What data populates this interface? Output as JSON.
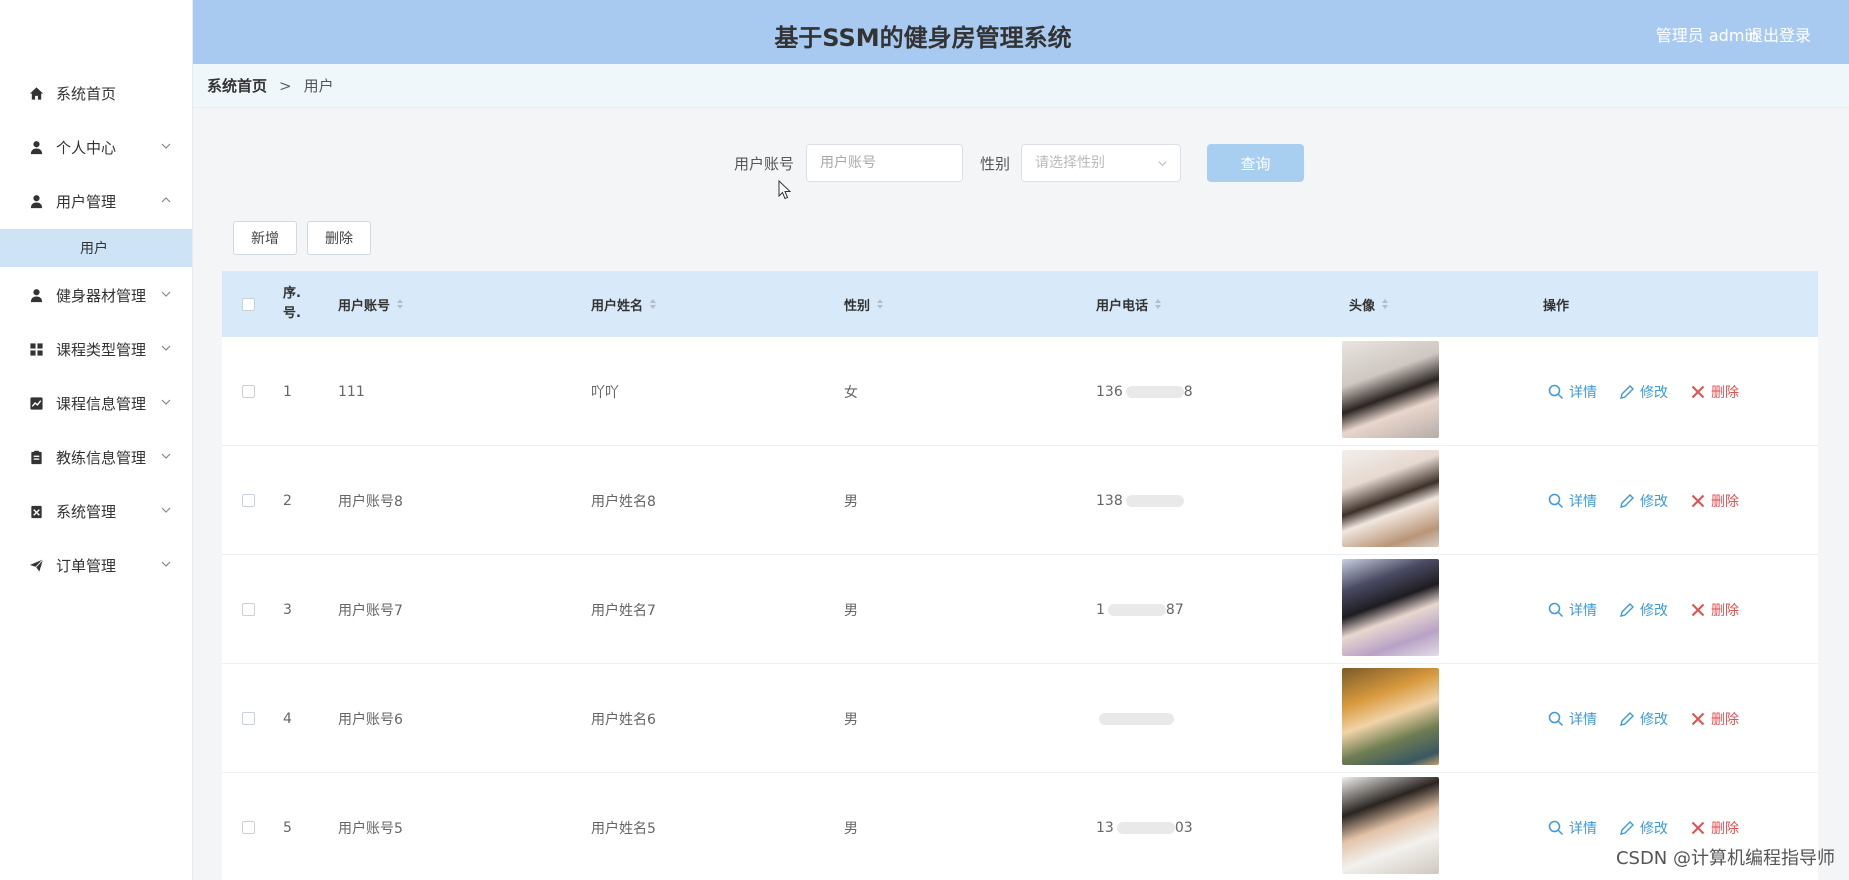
{
  "header": {
    "title": "基于SSM的健身房管理系统",
    "admin_label": "管理员 admin",
    "logout_label": "退出登录"
  },
  "sidebar": {
    "items": [
      {
        "label": "系统首页",
        "icon": "home-icon"
      },
      {
        "label": "个人中心",
        "icon": "user-icon"
      },
      {
        "label": "用户管理",
        "icon": "user-icon"
      },
      {
        "label": "健身器材管理",
        "icon": "user-icon"
      },
      {
        "label": "课程类型管理",
        "icon": "grid-icon"
      },
      {
        "label": "课程信息管理",
        "icon": "chart-icon"
      },
      {
        "label": "教练信息管理",
        "icon": "clipboard-icon"
      },
      {
        "label": "系统管理",
        "icon": "gear-icon"
      },
      {
        "label": "订单管理",
        "icon": "send-icon"
      }
    ],
    "sub_item": "用户"
  },
  "breadcrumb": {
    "home": "系统首页",
    "separator": ">",
    "current": "用户"
  },
  "search": {
    "account_label": "用户账号",
    "account_placeholder": "用户账号",
    "gender_label": "性别",
    "gender_placeholder": "请选择性别",
    "query_label": "查询"
  },
  "toolbar": {
    "add_label": "新增",
    "delete_label": "删除"
  },
  "table": {
    "columns": {
      "seq_line1": "序.",
      "seq_line2": "号.",
      "account": "用户账号",
      "name": "用户姓名",
      "gender": "性别",
      "phone": "用户电话",
      "avatar": "头像",
      "actions": "操作"
    },
    "rows": [
      {
        "seq": "1",
        "account": "111",
        "name": "吖吖",
        "gender": "女",
        "phone": "136",
        "phone_tail": "8"
      },
      {
        "seq": "2",
        "account": "用户账号8",
        "name": "用户姓名8",
        "gender": "男",
        "phone": "138",
        "phone_tail": ""
      },
      {
        "seq": "3",
        "account": "用户账号7",
        "name": "用户姓名7",
        "gender": "男",
        "phone": "1",
        "phone_tail": "87"
      },
      {
        "seq": "4",
        "account": "用户账号6",
        "name": "用户姓名6",
        "gender": "男",
        "phone": "",
        "phone_tail": ""
      },
      {
        "seq": "5",
        "account": "用户账号5",
        "name": "用户姓名5",
        "gender": "男",
        "phone": "13",
        "phone_tail": "03"
      }
    ],
    "action_labels": {
      "detail": "详情",
      "edit": "修改",
      "delete": "删除"
    }
  },
  "watermark": "CSDN @计算机编程指导师",
  "colors": {
    "header_bg": "#a8c9f0",
    "table_header_bg": "#d8eaf9",
    "sidebar_active_bg": "#cfe3f7",
    "link_blue": "#3b9bdc",
    "delete_red": "#e25050",
    "query_btn": "#a8cff0"
  }
}
